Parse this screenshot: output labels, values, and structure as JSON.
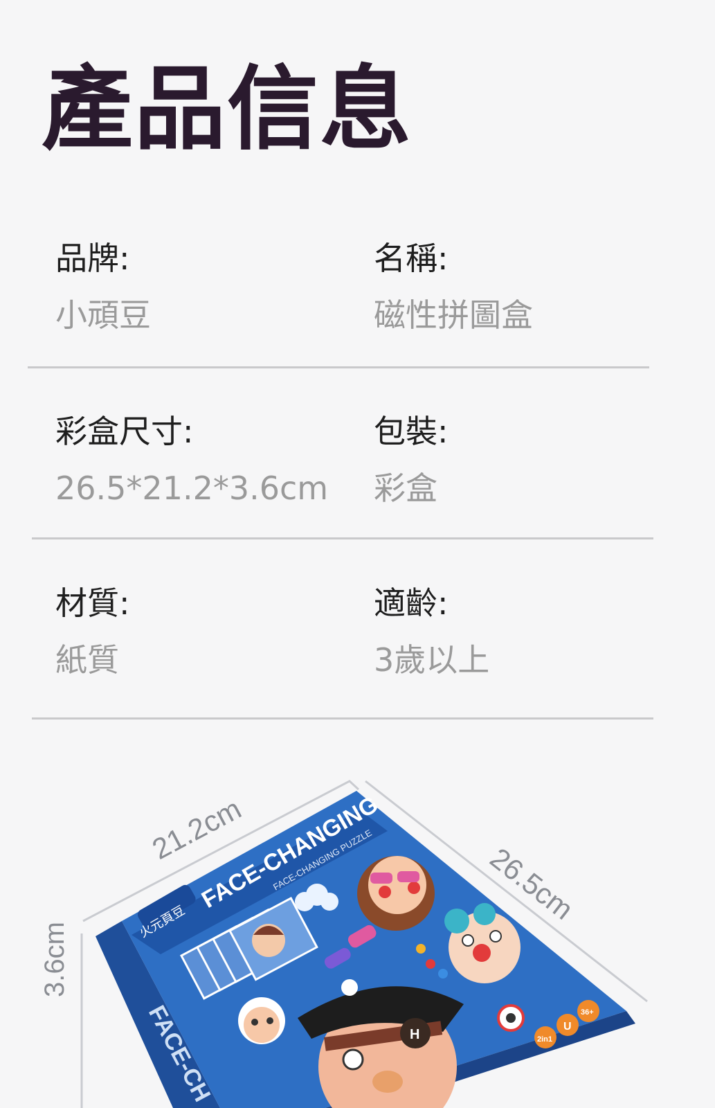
{
  "page_title": "產品信息",
  "specs": [
    {
      "label": "品牌:",
      "value": "小頑豆"
    },
    {
      "label": "名稱:",
      "value": "磁性拼圖盒"
    },
    {
      "label": "彩盒尺寸:",
      "value": "26.5*21.2*3.6cm"
    },
    {
      "label": "包裝:",
      "value": "彩盒"
    },
    {
      "label": "材質:",
      "value": "紙質"
    },
    {
      "label": "適齡:",
      "value": "3歲以上"
    }
  ],
  "product_image": {
    "dim_width": "21.2cm",
    "dim_length": "26.5cm",
    "dim_depth": "3.6cm",
    "box_title": "FACE-CHANGING",
    "box_subtitle": "FACE-CHANGING PUZZLE",
    "box_brand": "火元頁豆",
    "box_spine_text": "FACE-CH",
    "badge_2in1": "2in1",
    "badge_u": "U",
    "badge_age": "36+",
    "colors": {
      "box_blue": "#2e6fc4",
      "box_dark": "#1f4f9a",
      "accent_red": "#e23b3b"
    }
  }
}
